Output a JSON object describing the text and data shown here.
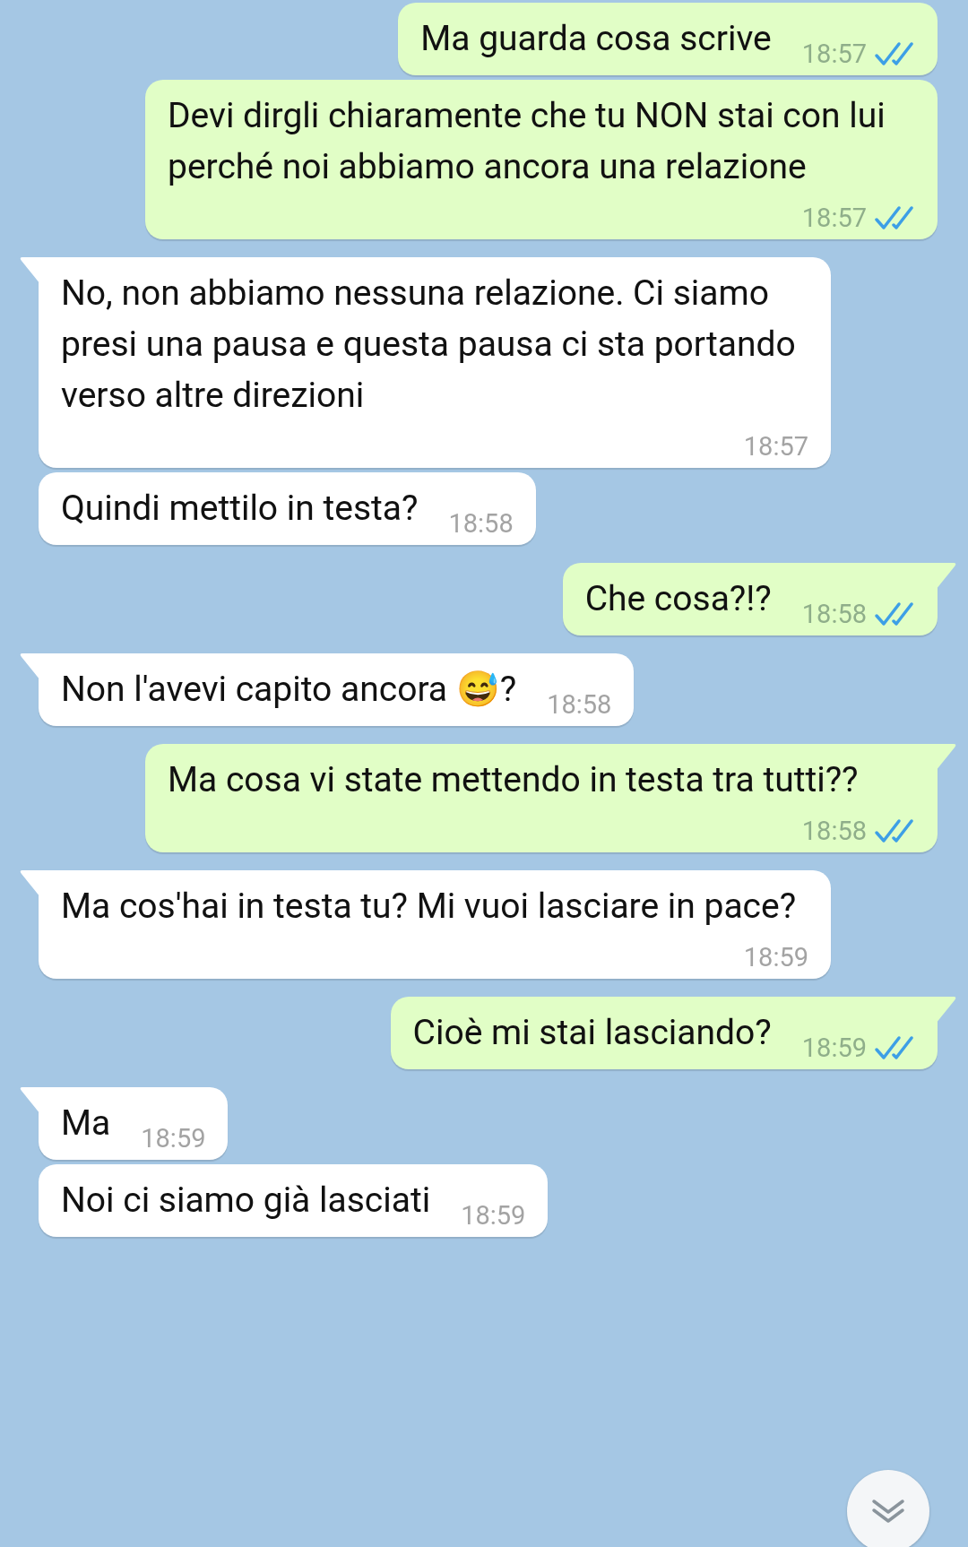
{
  "messages": [
    {
      "kind": "out",
      "text": "Ma guarda cosa scrive",
      "time": "18:57",
      "read": true,
      "tail": false
    },
    {
      "kind": "out",
      "text": "Devi dirgli chiaramente che tu NON stai con lui perché noi abbiamo ancora una relazione",
      "time": "18:57",
      "read": true,
      "tail": false
    },
    {
      "kind": "in",
      "text": "No, non abbiamo nessuna relazione. Ci siamo presi una pausa e questa pausa ci sta portando verso altre direzioni",
      "time": "18:57",
      "tail": true
    },
    {
      "kind": "in",
      "text": "Quindi mettilo in testa?",
      "time": "18:58",
      "tail": false
    },
    {
      "kind": "out",
      "text": "Che cosa?!?",
      "time": "18:58",
      "read": true,
      "tail": true
    },
    {
      "kind": "in",
      "text": "Non l'avevi capito ancora 😅?",
      "time": "18:58",
      "tail": true
    },
    {
      "kind": "out",
      "text": "Ma cosa vi state mettendo in testa tra tutti??",
      "time": "18:58",
      "read": true,
      "tail": true
    },
    {
      "kind": "in",
      "text": "Ma cos'hai in testa tu? Mi vuoi lasciare in pace?",
      "time": "18:59",
      "tail": true
    },
    {
      "kind": "out",
      "text": "Cioè mi stai lasciando?",
      "time": "18:59",
      "read": true,
      "tail": true
    },
    {
      "kind": "in",
      "text": "Ma",
      "time": "18:59",
      "tail": true
    },
    {
      "kind": "in",
      "text": "Noi ci siamo già lasciati",
      "time": "18:59",
      "tail": false
    }
  ]
}
